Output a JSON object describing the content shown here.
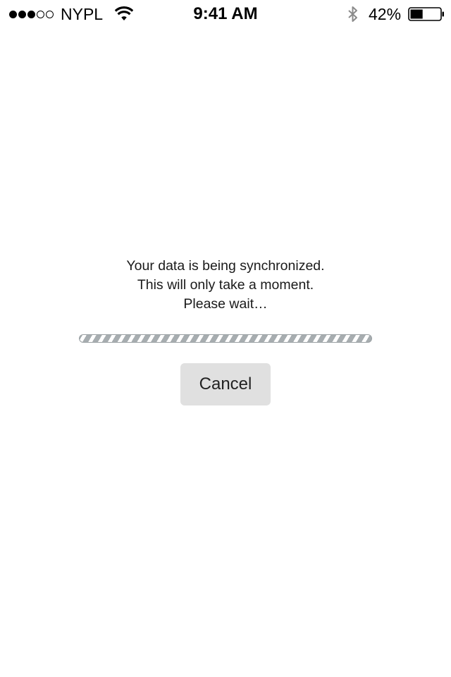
{
  "status_bar": {
    "signal_bars_filled": 3,
    "signal_bars_total": 5,
    "carrier": "NYPL",
    "wifi_icon": "wifi-icon",
    "time": "9:41 AM",
    "bluetooth_icon": "bluetooth-icon",
    "battery_percent_label": "42%",
    "battery_level": 0.42
  },
  "sync_dialog": {
    "message_line_1": "Your data is being synchronized.",
    "message_line_2": "This will only take a moment.",
    "message_line_3": "Please wait…",
    "progress_state": "indeterminate",
    "cancel_label": "Cancel"
  },
  "colors": {
    "progress_stripe": "#a7adb0",
    "button_bg": "#e0e0e0"
  }
}
